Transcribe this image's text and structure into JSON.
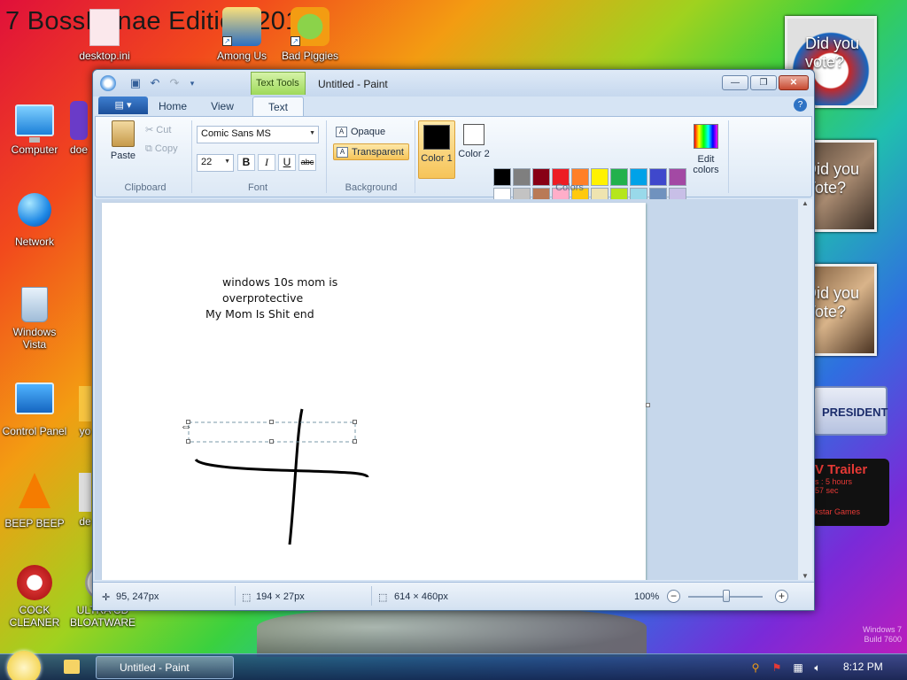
{
  "desktop": {
    "wallpaper_title": "7 BossKanae Edition 2012",
    "icons": [
      {
        "label": "desktop.ini"
      },
      {
        "label": "Among Us"
      },
      {
        "label": "Bad Piggies"
      },
      {
        "label": "Computer"
      },
      {
        "label": "doe"
      },
      {
        "label": "Network"
      },
      {
        "label": "Windows Vista"
      },
      {
        "label": "Control Panel"
      },
      {
        "label": "yo"
      },
      {
        "label": "BEEP BEEP"
      },
      {
        "label": "de"
      },
      {
        "label": "COCK CLEANER"
      },
      {
        "label": "ULTRA CD BLOATWARE"
      }
    ],
    "gadgets": {
      "vote_1": "Did you vote?",
      "vote_2": "Did you Vote?",
      "vote_3": "Did you Vote?",
      "president": "PRESIDENT",
      "trailer_title": "V Trailer",
      "trailer_line1": "s : 5 hours",
      "trailer_line2": "57 sec",
      "trailer_brand": "kstar Games"
    },
    "watermark_line1": "Windows 7",
    "watermark_line2": "Build 7600"
  },
  "window": {
    "title": "Untitled - Paint",
    "context_tab": "Text Tools",
    "buttons": {
      "minimize": "—",
      "restore": "❐",
      "close": "✕"
    },
    "tabs": {
      "home": "Home",
      "view": "View",
      "text": "Text"
    },
    "ribbon": {
      "clipboard": {
        "paste": "Paste",
        "cut": "Cut",
        "copy": "Copy",
        "label": "Clipboard"
      },
      "font": {
        "family": "Comic Sans MS",
        "size": "22",
        "bold": "B",
        "italic": "I",
        "underline": "U",
        "strike": "abc",
        "label": "Font"
      },
      "background": {
        "opaque": "Opaque",
        "transparent": "Transparent",
        "label": "Background"
      },
      "colors": {
        "color1_label": "Color 1",
        "color2_label": "Color 2",
        "edit_colors": "Edit colors",
        "label": "Colors",
        "color1": "#000000",
        "color2": "#ffffff",
        "palette": [
          "#000000",
          "#7f7f7f",
          "#880015",
          "#ed1c24",
          "#ff7f27",
          "#fff200",
          "#22b14c",
          "#00a2e8",
          "#3f48cc",
          "#a349a4",
          "#ffffff",
          "#c3c3c3",
          "#b97a57",
          "#ffaec9",
          "#ffc90e",
          "#efe4b0",
          "#b5e61d",
          "#99d9ea",
          "#7092be",
          "#c8bfe7",
          "#e8eef5",
          "#e8eef5",
          "#e8eef5",
          "#e8eef5",
          "#e8eef5",
          "#e8eef5",
          "#e8eef5",
          "#e8eef5",
          "#e8eef5",
          "#e8eef5"
        ]
      }
    },
    "canvas_text": {
      "line1": "windows 10s mom is",
      "line2": "overprotective",
      "line3": "My Mom Is Shit end"
    },
    "status": {
      "cursor": "95, 247px",
      "selection": "194 × 27px",
      "size": "614 × 460px",
      "zoom": "100%",
      "zoom_level_fraction": 0.5
    }
  },
  "taskbar": {
    "paint_item": "Untitled - Paint",
    "clock": "8:12 PM"
  }
}
